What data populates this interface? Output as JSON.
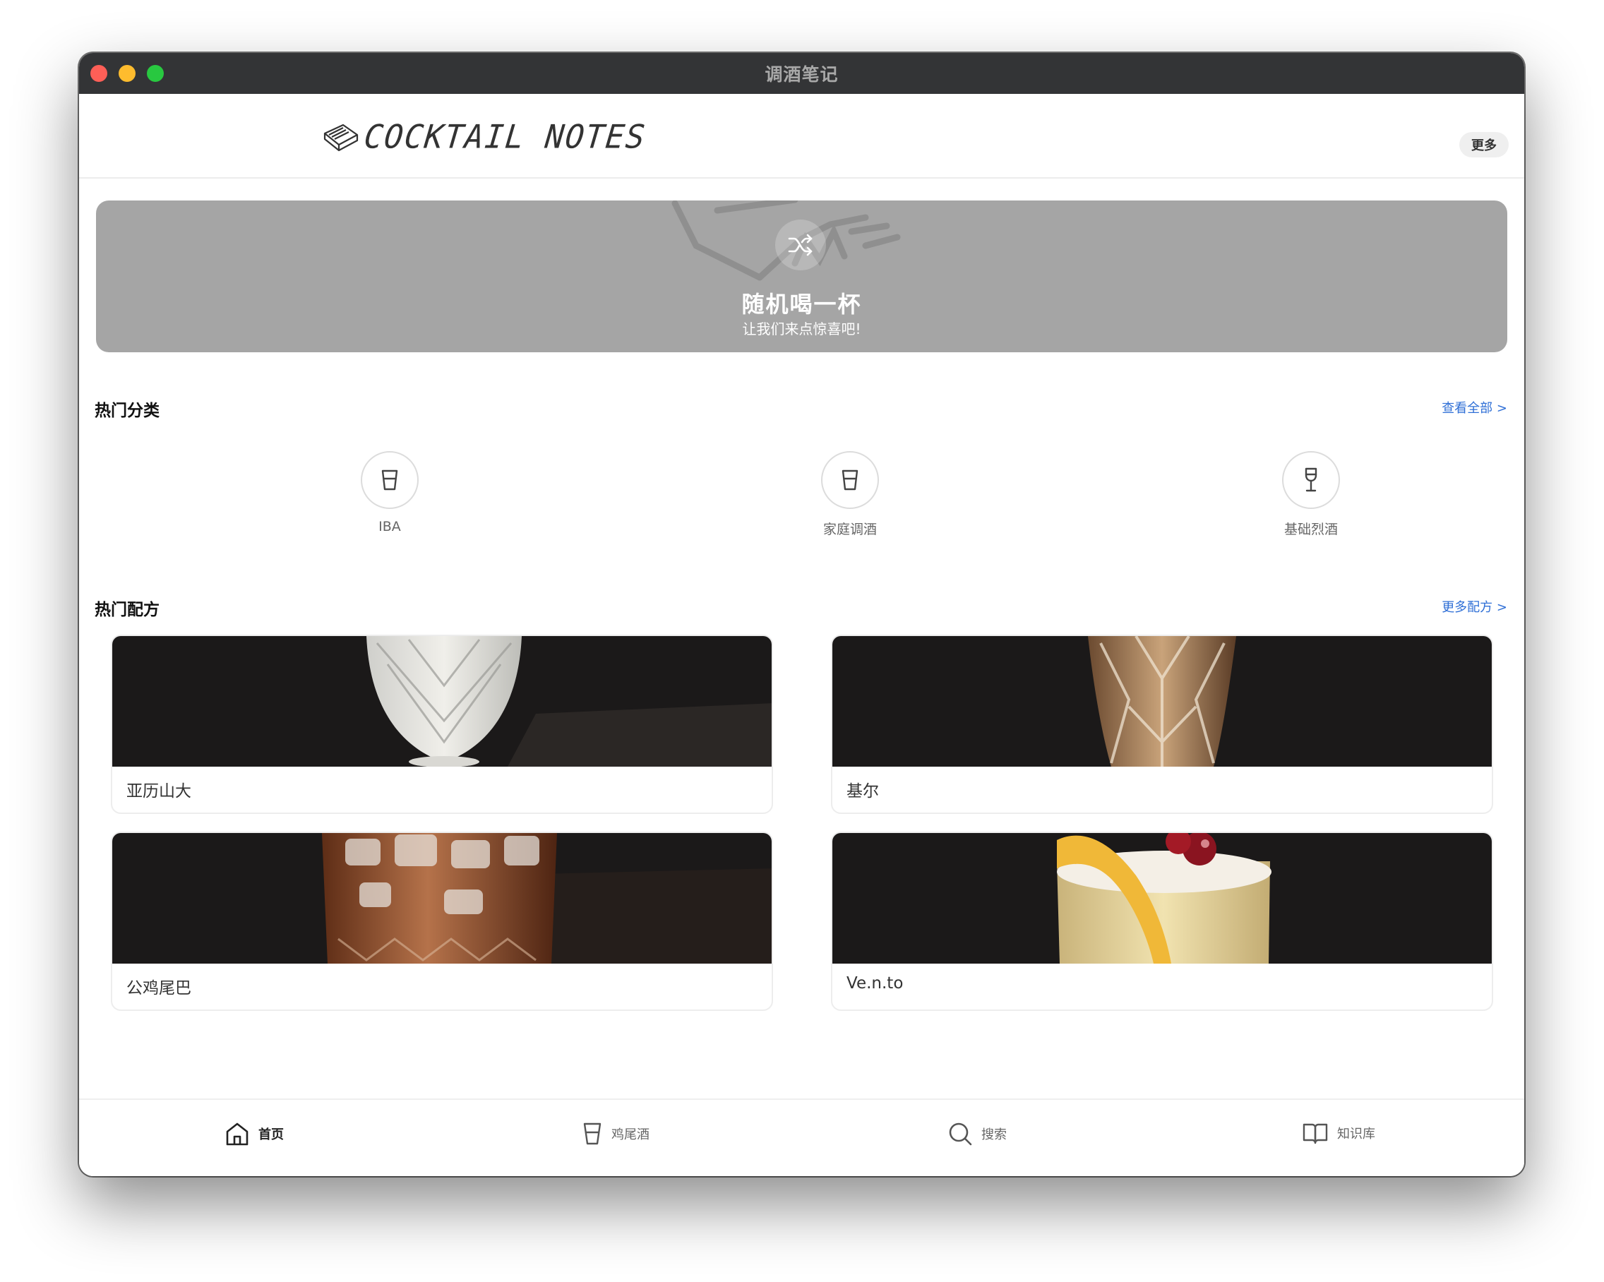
{
  "window": {
    "title": "调酒笔记"
  },
  "header": {
    "logo_text": "COCKTAIL NOTES",
    "more_label": "更多"
  },
  "banner": {
    "title": "随机喝一杯",
    "subtitle": "让我们来点惊喜吧!"
  },
  "categories": {
    "title": "热门分类",
    "link": "查看全部 >",
    "items": [
      {
        "label": "IBA",
        "icon": "cocktail-glass-icon"
      },
      {
        "label": "家庭调酒",
        "icon": "cocktail-glass-icon"
      },
      {
        "label": "基础烈酒",
        "icon": "wine-glass-icon"
      }
    ]
  },
  "recipes": {
    "title": "热门配方",
    "link": "更多配方 >",
    "items": [
      {
        "name": "亚历山大"
      },
      {
        "name": "基尔"
      },
      {
        "name": "公鸡尾巴"
      },
      {
        "name": "Ve.n.to"
      }
    ]
  },
  "tabbar": {
    "items": [
      {
        "label": "首页",
        "icon": "home-icon",
        "active": true
      },
      {
        "label": "鸡尾酒",
        "icon": "cocktail-glass-icon",
        "active": false
      },
      {
        "label": "搜索",
        "icon": "search-icon",
        "active": false
      },
      {
        "label": "知识库",
        "icon": "book-icon",
        "active": false
      }
    ]
  }
}
